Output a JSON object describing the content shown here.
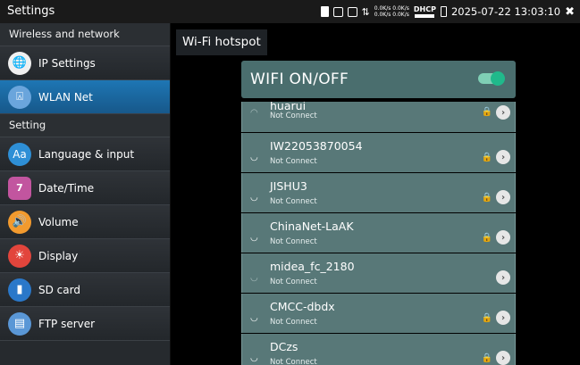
{
  "statusbar": {
    "title": "Settings",
    "speed_up": "0.0K/s 0.0K/s",
    "speed_down": "0.0K/s 0.0K/s",
    "dhcp": "DHCP",
    "datetime": "2025-07-22 13:03:10",
    "close": "✖"
  },
  "sidebar": {
    "section_network": "Wireless and network",
    "ip_settings": "IP Settings",
    "wlan_net": "WLAN Net",
    "section_setting": "Setting",
    "language": "Language & input",
    "date_time": "Date/Time",
    "volume": "Volume",
    "display": "Display",
    "sd_card": "SD card",
    "ftp_server": "FTP server",
    "date_icon_text": "7",
    "lang_icon_text": "Aa"
  },
  "page": {
    "title": "Wi-Fi hotspot",
    "wifi_toggle_label": "WIFI ON/OFF",
    "wifi_enabled": true
  },
  "networks": [
    {
      "ssid": "huarui",
      "status": "Not Connect",
      "locked": true
    },
    {
      "ssid": "IW22053870054",
      "status": "Not Connect",
      "locked": true
    },
    {
      "ssid": "JISHU3",
      "status": "Not Connect",
      "locked": true
    },
    {
      "ssid": "ChinaNet-LaAK",
      "status": "Not Connect",
      "locked": true
    },
    {
      "ssid": "midea_fc_2180",
      "status": "Not Connect",
      "locked": false
    },
    {
      "ssid": "CMCC-dbdx",
      "status": "Not Connect",
      "locked": true
    },
    {
      "ssid": "DCzs",
      "status": "Not Connect",
      "locked": true
    }
  ],
  "colors": {
    "active_item": "#1e76b4",
    "list_item": "#587878",
    "toggle_on": "#20b98b"
  }
}
